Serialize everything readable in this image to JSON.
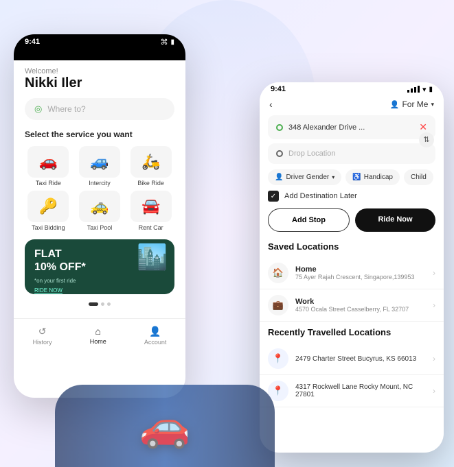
{
  "background": {
    "color": "#eef2ff"
  },
  "phone_left": {
    "status_time": "9:41",
    "welcome": "Welcome!",
    "user_name": "Nikki Iler",
    "search_placeholder": "Where to?",
    "section_title": "Select the service you want",
    "services": [
      {
        "label": "Taxi Ride",
        "icon": "🚗"
      },
      {
        "label": "Intercity",
        "icon": "🚙"
      },
      {
        "label": "Bike Ride",
        "icon": "🛵"
      },
      {
        "label": "Taxi Bidding",
        "icon": "🔑"
      },
      {
        "label": "Taxi Pool",
        "icon": "🚕"
      },
      {
        "label": "Rent Car",
        "icon": "🚘"
      }
    ],
    "promo": {
      "headline": "FLAT\n10% OFF*",
      "subtext": "*on your first ride",
      "link": "RIDE NOW",
      "icon": "🏙️"
    },
    "nav": [
      {
        "label": "History",
        "icon": "↺",
        "active": false
      },
      {
        "label": "Home",
        "icon": "⌂",
        "active": true
      },
      {
        "label": "Account",
        "icon": "👤",
        "active": false
      }
    ]
  },
  "phone_right": {
    "status_time": "9:41",
    "back_label": "‹",
    "for_me": "For Me",
    "pickup_address": "348 Alexander Drive ...",
    "drop_placeholder": "Drop Location",
    "options": [
      {
        "label": "Driver Gender",
        "icon": "👤"
      },
      {
        "label": "Handicap",
        "icon": "♿"
      },
      {
        "label": "Child",
        "icon": "👶"
      }
    ],
    "checkbox_label": "Add Destination Later",
    "add_stop": "Add Stop",
    "ride_now": "Ride Now",
    "saved_title": "Saved Locations",
    "saved": [
      {
        "icon": "🏠",
        "name": "Home",
        "address": "75 Ayer Rajah Crescent, Singapore,139953"
      },
      {
        "icon": "💼",
        "name": "Work",
        "address": "4570 Ocala Street Casselberry, FL 32707"
      }
    ],
    "recent_title": "Recently Travelled Locations",
    "recent": [
      {
        "icon": "📍",
        "address": "2479 Charter Street Bucyrus, KS 66013"
      },
      {
        "icon": "📍",
        "address": "4317 Rockwell Lane Rocky Mount, NC 27801"
      }
    ]
  }
}
